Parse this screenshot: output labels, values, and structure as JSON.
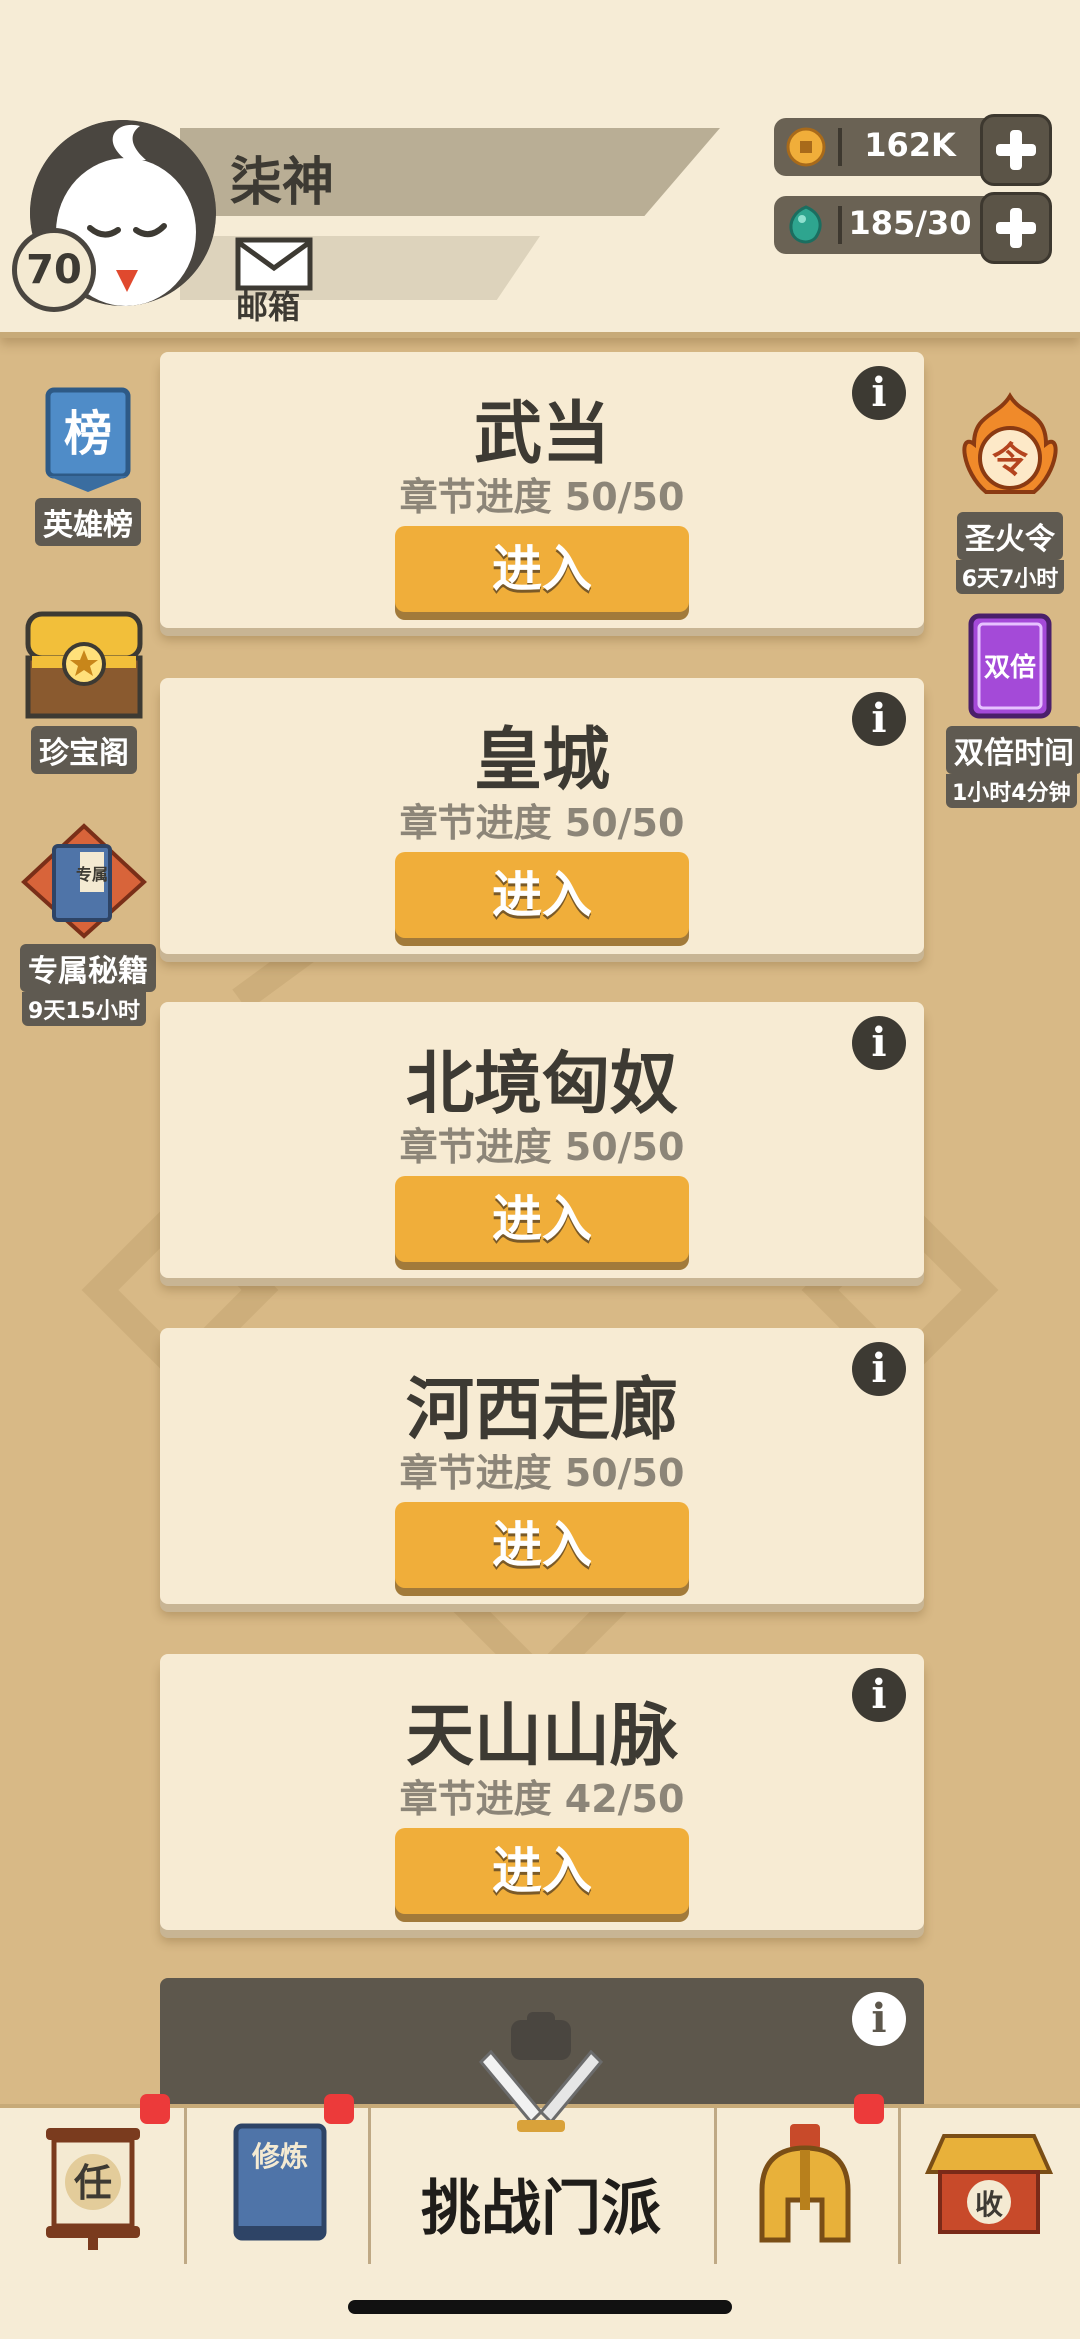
{
  "player": {
    "name": "柒神",
    "level": "70",
    "mail_label": "邮箱"
  },
  "resources": {
    "coins": "162K",
    "energy": "185/30"
  },
  "left_menu": [
    {
      "label": "英雄榜",
      "icon_text": "榜"
    },
    {
      "label": "珍宝阁"
    },
    {
      "label": "专属秘籍",
      "timer": "9天15小时",
      "icon_text": "专属"
    }
  ],
  "right_menu": [
    {
      "label": "圣火令",
      "timer": "6天7小时",
      "icon_text": "令"
    },
    {
      "label": "双倍时间",
      "timer": "1小时4分钟",
      "icon_text": "双倍"
    }
  ],
  "enter_label": "进入",
  "stages": [
    {
      "title": "武当",
      "progress": "章节进度 50/50"
    },
    {
      "title": "皇城",
      "progress": "章节进度 50/50"
    },
    {
      "title": "北境匈奴",
      "progress": "章节进度 50/50"
    },
    {
      "title": "河西走廊",
      "progress": "章节进度 50/50"
    },
    {
      "title": "天山山脉",
      "progress": "章节进度 42/50"
    }
  ],
  "bottom_nav": {
    "task_icon_text": "任",
    "train_icon_text": "修炼",
    "center_label": "挑战门派",
    "collect_icon_text": "收"
  },
  "colors": {
    "accent_button": "#f0ae3a",
    "notification": "#ec3a3a",
    "background": "#d8b986"
  }
}
